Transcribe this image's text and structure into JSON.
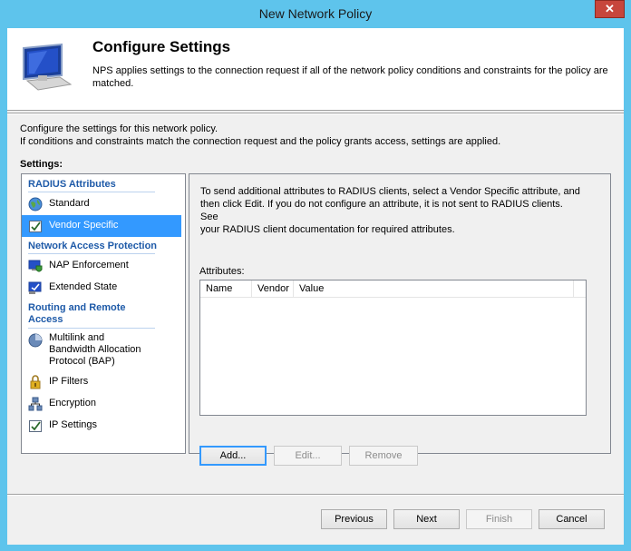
{
  "window": {
    "title": "New Network Policy",
    "close_label": "✕"
  },
  "header": {
    "title": "Configure Settings",
    "description_line1": "NPS applies settings to the connection request if all of the network policy conditions and constraints for the policy are",
    "description_line2": "matched."
  },
  "intro": {
    "line1": "Configure the settings for this network policy.",
    "line2": "If conditions and constraints match the connection request and the policy grants access, settings are applied."
  },
  "settings_label": "Settings:",
  "nav": {
    "group_radius": "RADIUS Attributes",
    "standard": "Standard",
    "vendor_specific": "Vendor Specific",
    "group_nap": "Network Access Protection",
    "nap_enforcement": "NAP Enforcement",
    "extended_state": "Extended State",
    "group_routing_1": "Routing and Remote",
    "group_routing_2": "Access",
    "multilink_1": "Multilink and",
    "multilink_2": "Bandwidth Allocation",
    "multilink_3": "Protocol (BAP)",
    "ip_filters": "IP Filters",
    "encryption": "Encryption",
    "ip_settings": "IP Settings",
    "selected": "Vendor Specific"
  },
  "content": {
    "info_line1": "To send additional attributes to RADIUS clients, select a Vendor Specific attribute, and",
    "info_line2": "then click Edit. If you do not configure an attribute, it is not sent to RADIUS clients. See",
    "info_line3": "your RADIUS client documentation for required attributes.",
    "attributes_label": "Attributes:",
    "columns": [
      "Name",
      "Vendor",
      "Value"
    ],
    "rows": [],
    "add_label": "Add...",
    "edit_label": "Edit...",
    "remove_label": "Remove"
  },
  "footer": {
    "previous_label": "Previous",
    "next_label": "Next",
    "finish_label": "Finish",
    "cancel_label": "Cancel"
  },
  "colors": {
    "titlebar": "#5ec4ec",
    "close": "#c7463c",
    "selection": "#3399ff",
    "group_heading": "#1e5aa8"
  }
}
